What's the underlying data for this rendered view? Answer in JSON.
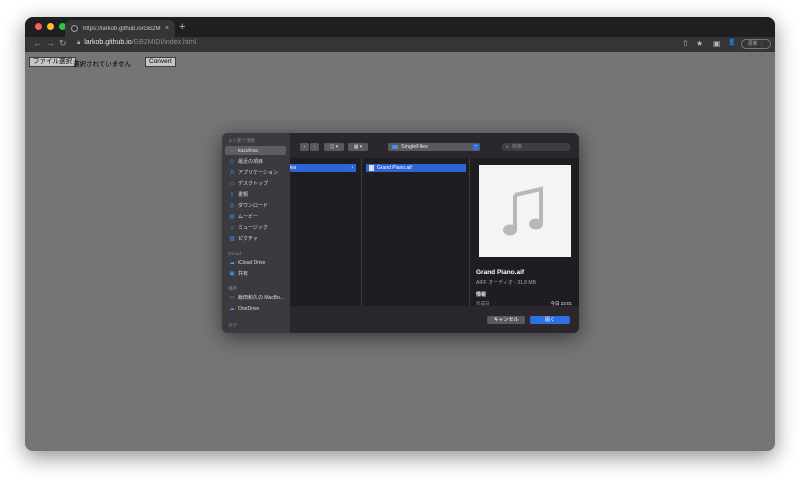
{
  "browser": {
    "tab_title": "https://larkob.github.io/GB2MIDI",
    "tab_close": "×",
    "new_tab": "+",
    "url_host": "larkob.github.io",
    "url_path": "/GB2MIDI/index.html",
    "back": "←",
    "forward": "→",
    "reload": "↻",
    "share": "⇧",
    "bookmark": "★",
    "sidepanel": "▣",
    "profile": "👤",
    "update_label": "更新",
    "menu": "⋮"
  },
  "page": {
    "file_button": "ファイル選択",
    "file_status": "選択されていません",
    "convert_button": "Convert"
  },
  "dialog": {
    "sidebar": {
      "favorites_header": "よく使う項目",
      "favorites": [
        {
          "icon": "⌂",
          "label": "kazuhisa"
        },
        {
          "icon": "◷",
          "label": "最近の項目"
        },
        {
          "icon": "⋀",
          "label": "アプリケーション"
        },
        {
          "icon": "▭",
          "label": "デスクトップ"
        },
        {
          "icon": "▯",
          "label": "書類"
        },
        {
          "icon": "◎",
          "label": "ダウンロード"
        },
        {
          "icon": "▤",
          "label": "ムービー"
        },
        {
          "icon": "♫",
          "label": "ミュージック"
        },
        {
          "icon": "▨",
          "label": "ピクチャ"
        }
      ],
      "icloud_header": "iCloud",
      "icloud": [
        {
          "icon": "☁",
          "label": "iCloud Drive"
        },
        {
          "icon": "▣",
          "label": "共有"
        }
      ],
      "locations_header": "場所",
      "locations": [
        {
          "icon": "▭",
          "label": "飯田和久の MacBo..."
        },
        {
          "icon": "☁",
          "label": "OneDrive"
        }
      ],
      "tags_header": "タグ"
    },
    "toolbar": {
      "back": "‹",
      "forward": "›",
      "view_columns": "◫ ▾",
      "view_group": "▦ ▾",
      "current_folder": "SingleFiles",
      "folder_arrows": "⌃",
      "search_icon": "⌕",
      "search_placeholder": "検索"
    },
    "columns": {
      "col1_selected": "les",
      "col1_arrow": "›",
      "col2_selected": "Grand Piano.aif"
    },
    "preview": {
      "name": "Grand Piano.aif",
      "kind": "AIFF オーディオ - 31.8 MB",
      "info_header": "情報",
      "created_label": "作成日",
      "created_value": "今日 23:01"
    },
    "cancel_label": "キャンセル",
    "open_label": "開く"
  }
}
